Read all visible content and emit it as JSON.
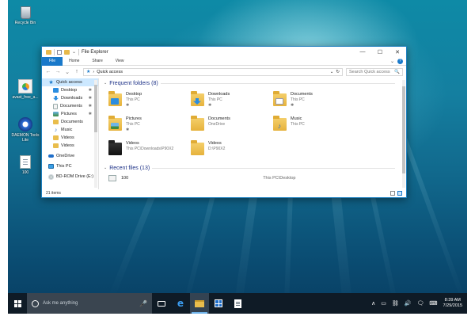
{
  "desktop": {
    "icons": [
      {
        "label": "Recycle Bin",
        "icon": "recycle-bin-icon"
      },
      {
        "label": "avast_free_a...",
        "icon": "installer-icon"
      },
      {
        "label": "DAEMON Tools Lite",
        "icon": "daemon-tools-icon"
      },
      {
        "label": "100",
        "icon": "text-file-icon"
      }
    ]
  },
  "window": {
    "title": "File Explorer",
    "controls": {
      "minimize": "—",
      "maximize": "☐",
      "close": "✕"
    },
    "ribbon_tabs": [
      "File",
      "Home",
      "Share",
      "View"
    ],
    "ribbon_expand": "⌄",
    "help": "?",
    "nav_buttons": {
      "back": "←",
      "forward": "→",
      "recent": "⌄",
      "up": "↑"
    },
    "address": {
      "separator": "›",
      "path": "Quick access",
      "dropdown": "⌄",
      "refresh": "↻"
    },
    "search": {
      "placeholder": "Search Quick access",
      "icon": "🔍"
    }
  },
  "nav_pane": {
    "pin_glyph": "✱",
    "items": [
      {
        "label": "Quick access",
        "icon": "star",
        "level": 0,
        "selected": true,
        "pinned": false
      },
      {
        "label": "Desktop",
        "icon": "blue",
        "level": 1,
        "selected": false,
        "pinned": true
      },
      {
        "label": "Downloads",
        "icon": "dl",
        "level": 1,
        "selected": false,
        "pinned": true
      },
      {
        "label": "Documents",
        "icon": "doc",
        "level": 1,
        "selected": false,
        "pinned": true
      },
      {
        "label": "Pictures",
        "icon": "pic",
        "level": 1,
        "selected": false,
        "pinned": true
      },
      {
        "label": "Documents",
        "icon": "folder",
        "level": 1,
        "selected": false,
        "pinned": false
      },
      {
        "label": "Music",
        "icon": "music",
        "level": 1,
        "selected": false,
        "pinned": false
      },
      {
        "label": "Videos",
        "icon": "folder",
        "level": 1,
        "selected": false,
        "pinned": false
      },
      {
        "label": "Videos",
        "icon": "folder",
        "level": 1,
        "selected": false,
        "pinned": false
      },
      {
        "label": "OneDrive",
        "icon": "cloud",
        "level": 0,
        "selected": false,
        "pinned": false,
        "gap_before": true
      },
      {
        "label": "This PC",
        "icon": "pc",
        "level": 0,
        "selected": false,
        "pinned": false,
        "gap_before": true
      },
      {
        "label": "BD-ROM Drive (E:)",
        "icon": "disc",
        "level": 0,
        "selected": false,
        "pinned": false,
        "gap_before": true
      }
    ]
  },
  "content": {
    "frequent_header": "Frequent folders (8)",
    "collapse_glyph": "⌄",
    "pin_glyph": "✱",
    "folders": [
      {
        "name": "Desktop",
        "location": "This PC",
        "pinned": true,
        "overlay": "desk"
      },
      {
        "name": "Downloads",
        "location": "This PC",
        "pinned": true,
        "overlay": "dl"
      },
      {
        "name": "Documents",
        "location": "This PC",
        "pinned": true,
        "overlay": "doc"
      },
      {
        "name": "Pictures",
        "location": "This PC",
        "pinned": true,
        "overlay": "pic"
      },
      {
        "name": "Documents",
        "location": "OneDrive",
        "pinned": false,
        "overlay": "none"
      },
      {
        "name": "Music",
        "location": "This PC",
        "pinned": false,
        "overlay": "music"
      },
      {
        "name": "Videos",
        "location": "This PC\\Downloads\\P90X2",
        "pinned": false,
        "overlay": "dark"
      },
      {
        "name": "Videos",
        "location": "D:\\P90X2",
        "pinned": false,
        "overlay": "none"
      }
    ],
    "recent_header": "Recent files (13)",
    "recent": [
      {
        "name": "100",
        "location": "This PC\\Desktop"
      }
    ]
  },
  "status": {
    "count": "21 items"
  },
  "taskbar": {
    "search_placeholder": "Ask me anything",
    "mic": "🎤",
    "apps": [
      "task-view",
      "edge",
      "file-explorer",
      "store",
      "document-viewer"
    ],
    "tray_glyphs": {
      "chevron": "∧",
      "battery": "▭",
      "network": "⛓",
      "volume": "🔊",
      "notifications": "🗨",
      "keyboard": "⌨"
    },
    "time": "8:39 AM",
    "date": "7/29/2015"
  },
  "colors": {
    "accent": "#1979ca",
    "selection": "#cce8ff",
    "taskbar": "#0f1b26",
    "folder": "#e9bd4c"
  }
}
